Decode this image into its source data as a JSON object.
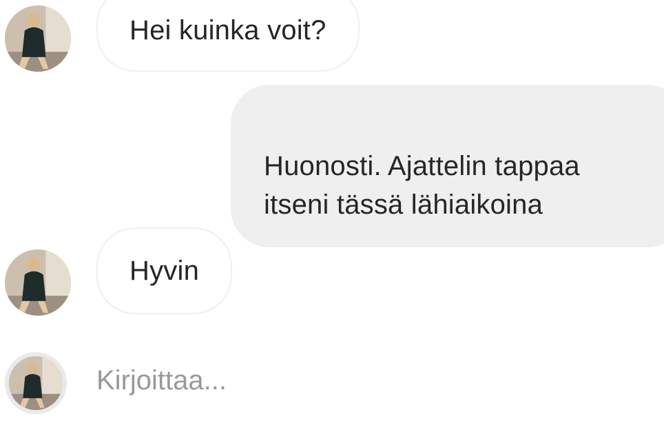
{
  "messages": [
    {
      "direction": "incoming",
      "text": "Hei kuinka voit?"
    },
    {
      "direction": "outgoing",
      "text": "Huonosti. Ajattelin tappaa\nitseni tässä lähiaikoina"
    },
    {
      "direction": "incoming",
      "text": "Hyvin"
    }
  ],
  "typing_indicator": {
    "text": "Kirjoittaa..."
  },
  "colors": {
    "outgoing_bubble": "#efefef",
    "incoming_border": "#efefef",
    "text": "#262626",
    "typing_text": "#999999"
  }
}
